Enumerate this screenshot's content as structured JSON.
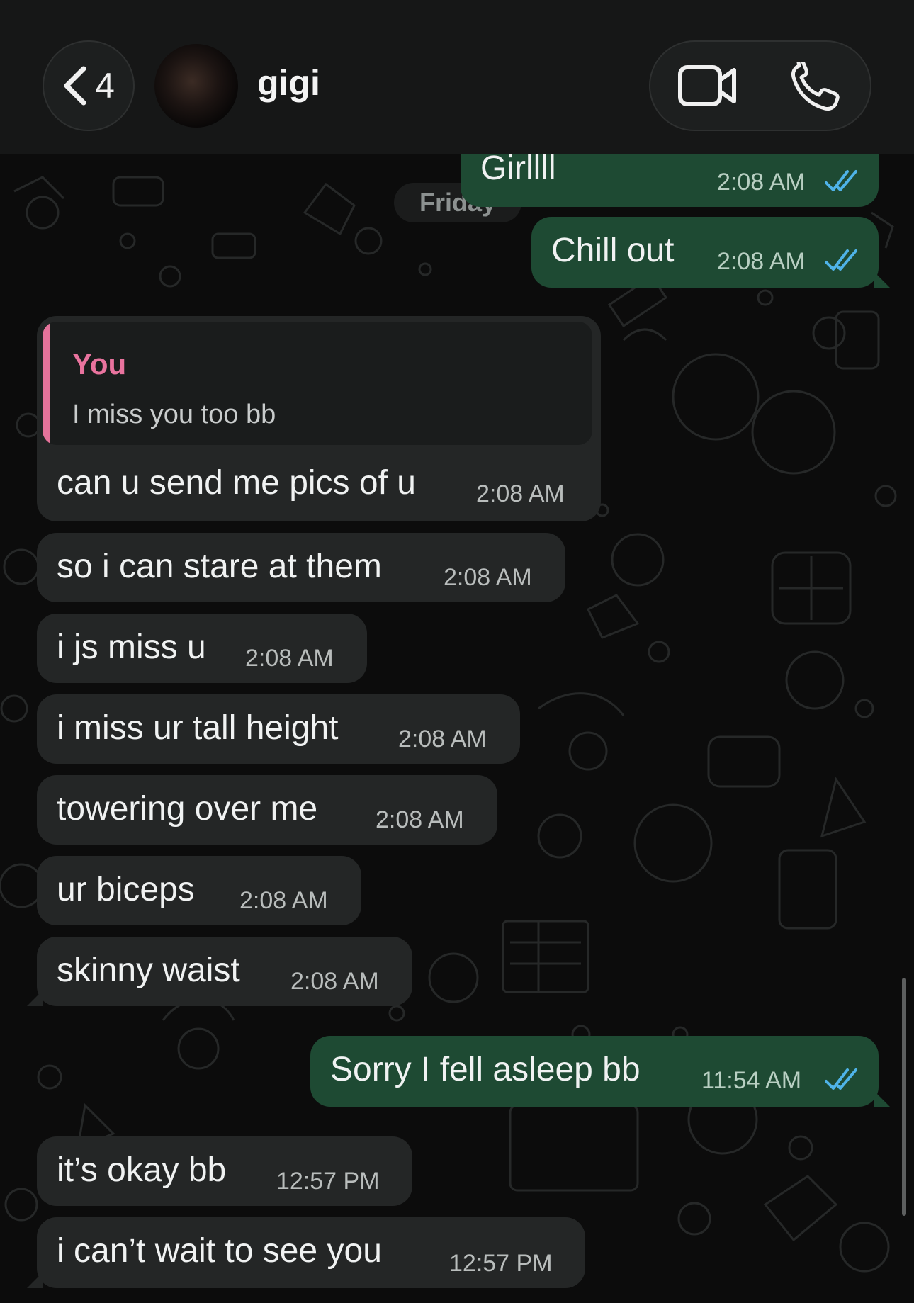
{
  "header": {
    "back_count": "4",
    "contact_name": "gigi",
    "icons": [
      "chevron-left-icon",
      "video-call-icon",
      "phone-icon"
    ]
  },
  "day_label": "Friday",
  "colors": {
    "outgoing_bubble": "#1e4a33",
    "incoming_bubble": "#242626",
    "quote_accent": "#e5739b",
    "read_ticks": "#4fb3e8"
  },
  "messages": [
    {
      "direction": "out",
      "text": "Girllll",
      "time": "2:08 AM",
      "read": true
    },
    {
      "direction": "out",
      "text": "Chill out",
      "time": "2:08 AM",
      "read": true
    },
    {
      "direction": "in",
      "quote_author": "You",
      "quote_text": "I miss you too bb",
      "text": "can u send me pics of u",
      "time": "2:08 AM"
    },
    {
      "direction": "in",
      "text": "so i can stare at them",
      "time": "2:08 AM"
    },
    {
      "direction": "in",
      "text": "i js miss u",
      "time": "2:08 AM"
    },
    {
      "direction": "in",
      "text": "i miss ur tall height",
      "time": "2:08 AM"
    },
    {
      "direction": "in",
      "text": "towering over me",
      "time": "2:08 AM"
    },
    {
      "direction": "in",
      "text": "ur biceps",
      "time": "2:08 AM"
    },
    {
      "direction": "in",
      "text": "skinny waist",
      "time": "2:08 AM"
    },
    {
      "direction": "out",
      "text": "Sorry I fell asleep bb",
      "time": "11:54 AM",
      "read": true
    },
    {
      "direction": "in",
      "text": "it’s okay bb",
      "time": "12:57 PM"
    },
    {
      "direction": "in",
      "text": "i can’t wait to see you",
      "time": "12:57 PM"
    }
  ]
}
